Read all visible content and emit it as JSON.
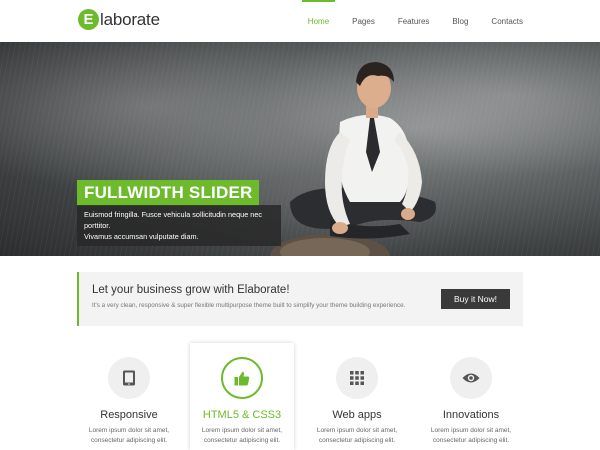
{
  "brand": {
    "letter": "E",
    "name": "laborate",
    "accent": "#6dbb2c"
  },
  "nav": {
    "items": [
      {
        "label": "Home",
        "active": true
      },
      {
        "label": "Pages"
      },
      {
        "label": "Features"
      },
      {
        "label": "Blog"
      },
      {
        "label": "Contacts"
      }
    ]
  },
  "hero": {
    "title": "FULLWIDTH SLIDER",
    "text_line1": "Euismod fringilla. Fusce vehicula sollicitudin neque nec porttitor.",
    "text_line2": "Vivamus accumsan vulputate diam."
  },
  "cta": {
    "title": "Let your business grow with Elaborate!",
    "subtitle": "It's a very clean, responsive & super flexible multipurpose theme built to simplify your theme building experience.",
    "button": "Buy it Now!"
  },
  "features": [
    {
      "icon": "tablet-icon",
      "title": "Responsive",
      "line1": "Lorem ipsum dolor sit amet,",
      "line2": "consectetur adipiscing elit."
    },
    {
      "icon": "thumbs-up-icon",
      "title": "HTML5 & CSS3",
      "line1": "Lorem ipsum dolor sit amet,",
      "line2": "consectetur adipiscing elit."
    },
    {
      "icon": "grid-icon",
      "title": "Web apps",
      "line1": "Lorem ipsum dolor sit amet,",
      "line2": "consectetur adipiscing elit."
    },
    {
      "icon": "eye-icon",
      "title": "Innovations",
      "line1": "Lorem ipsum dolor sit amet,",
      "line2": "consectetur adipiscing elit."
    }
  ]
}
